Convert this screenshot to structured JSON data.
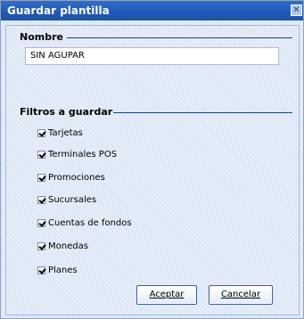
{
  "window": {
    "title": "Guardar plantilla",
    "close_glyph": "✕"
  },
  "form": {
    "name_section": "Nombre",
    "name_value": "SIN AGUPAR",
    "filters_section": "Filtros a guardar",
    "filters": [
      {
        "label": "Tarjetas",
        "checked": true
      },
      {
        "label": "Terminales POS",
        "checked": true
      },
      {
        "label": "Promociones",
        "checked": true
      },
      {
        "label": "Sucursales",
        "checked": true
      },
      {
        "label": "Cuentas de fondos",
        "checked": true
      },
      {
        "label": "Monedas",
        "checked": true
      },
      {
        "label": "Planes",
        "checked": true
      }
    ]
  },
  "buttons": {
    "accept": "Aceptar",
    "cancel": "Cancelar"
  }
}
